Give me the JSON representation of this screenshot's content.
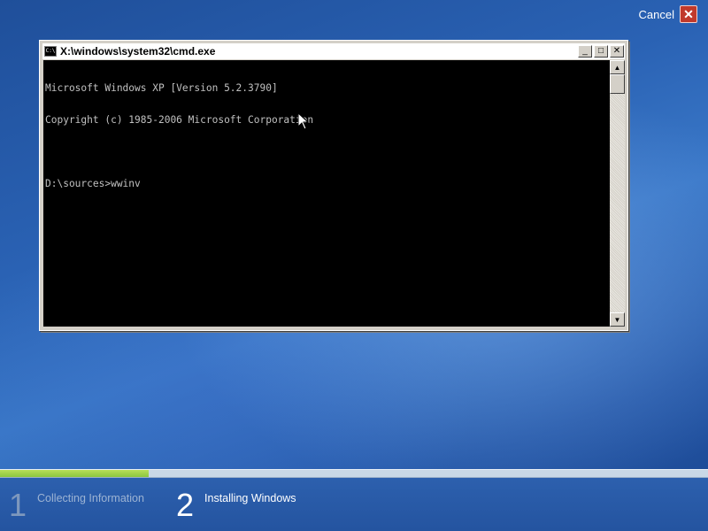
{
  "cancel": {
    "label": "Cancel",
    "icon": "close-icon"
  },
  "cmd": {
    "title": "X:\\windows\\system32\\cmd.exe",
    "icon_text": "C:\\",
    "lines": [
      "Microsoft Windows XP [Version 5.2.3790]",
      "Copyright (c) 1985-2006 Microsoft Corporation",
      "",
      "D:\\sources>wwinv"
    ]
  },
  "progress": {
    "value": 0.21,
    "fill_color": "#8cc63f"
  },
  "steps": [
    {
      "number": "1",
      "label": "Collecting Information"
    },
    {
      "number": "2",
      "label": "Installing Windows"
    }
  ]
}
